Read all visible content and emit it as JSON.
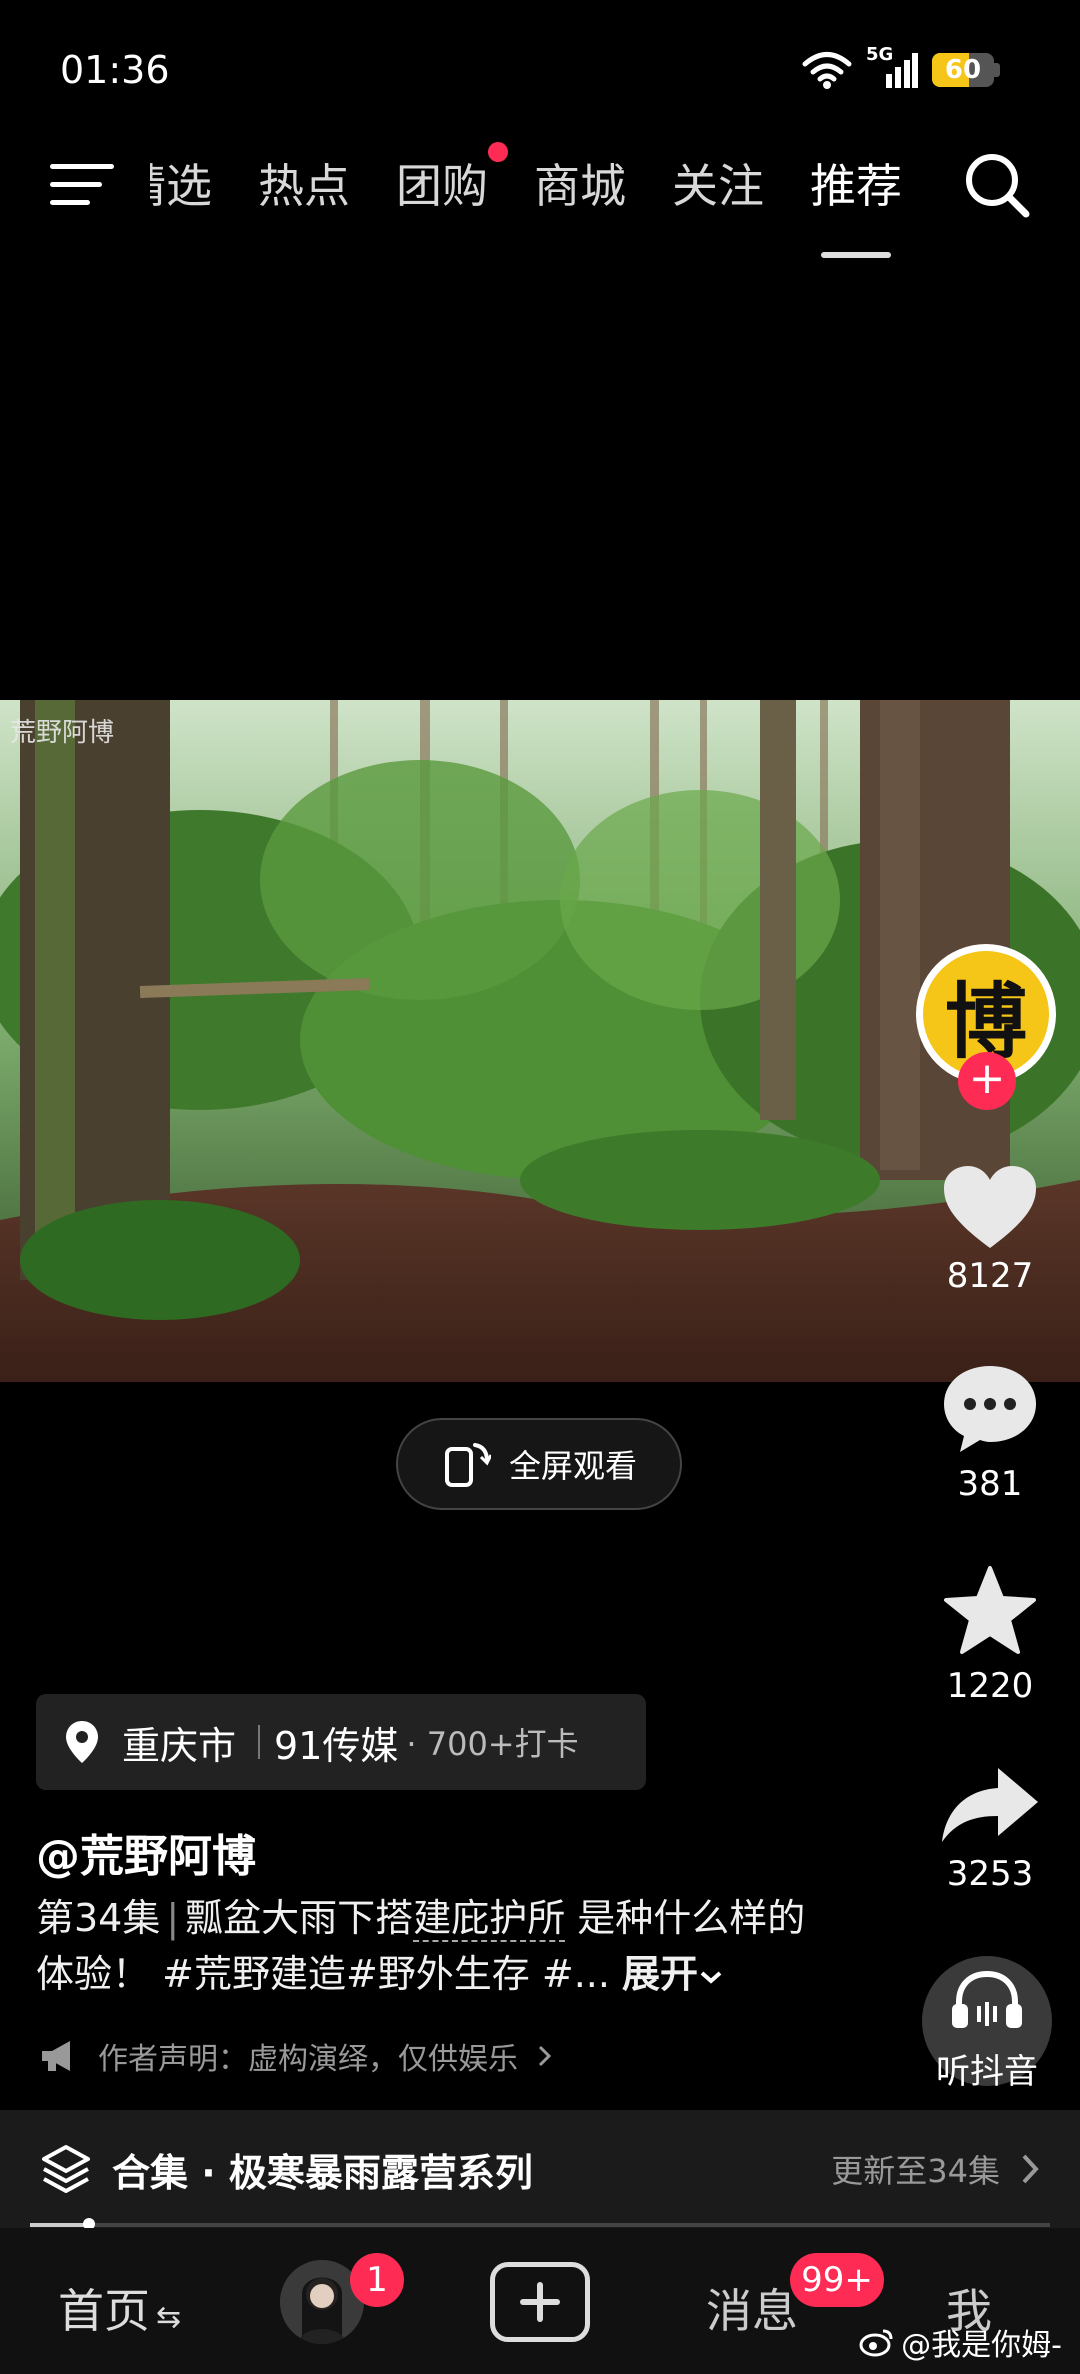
{
  "status_bar": {
    "time": "01:36",
    "network": "5G",
    "battery": "60",
    "battery_fraction": 0.6,
    "battery_color": "#f5c518"
  },
  "top_nav": {
    "tabs": [
      {
        "label": "精选"
      },
      {
        "label": "热点"
      },
      {
        "label": "团购",
        "has_dot": true
      },
      {
        "label": "商城"
      },
      {
        "label": "关注"
      },
      {
        "label": "推荐",
        "active": true
      }
    ],
    "icons": [
      "menu-icon",
      "search-icon"
    ]
  },
  "video": {
    "watermark": "荒野阿博",
    "fullscreen_label": "全屏观看"
  },
  "right_rail": {
    "author_avatar_text": "博",
    "follow_symbol": "+",
    "likes": "8127",
    "comments": "381",
    "favorites": "1220",
    "shares": "3253",
    "listen_label": "听抖音",
    "accent_color": "#fe2c55"
  },
  "post": {
    "location": {
      "city": "重庆市",
      "place": "91传媒",
      "checkins": "· 700+打卡"
    },
    "author": "@荒野阿博",
    "episode": "第34集",
    "title_pre": "瓢盆大雨下搭",
    "title_underlined": "建庇护所",
    "title_post": "是种什么样的体验！",
    "hashtags": "#荒野建造#野外生存 #...",
    "expand_label": "展开",
    "disclaimer": "作者声明：虚构演绎，仅供娱乐"
  },
  "collection": {
    "title": "合集 · 极寒暴雨露营系列",
    "update_text": "更新至34集",
    "progress_fraction": 0.058
  },
  "bottom_nav": {
    "home_label": "首页",
    "friends_badge": "1",
    "messages_label": "消息",
    "messages_badge": "99+",
    "me_label": "我"
  },
  "credit": "@我是你姆-"
}
